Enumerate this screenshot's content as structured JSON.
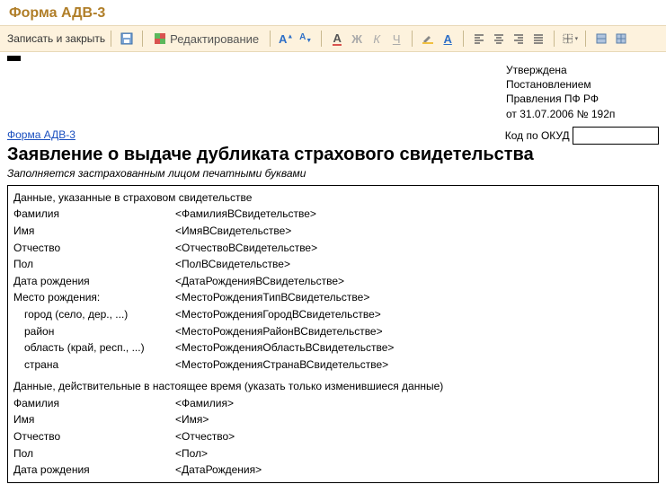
{
  "window_title": "Форма АДВ-3",
  "toolbar": {
    "save_close": "Записать и закрыть",
    "edit": "Редактирование"
  },
  "approval": {
    "l1": "Утверждена",
    "l2": "Постановлением",
    "l3": "Правления ПФ РФ",
    "l4": "от 31.07.2006 № 192п"
  },
  "form_link": "Форма АДВ-3",
  "okud_label": "Код по ОКУД",
  "okud_value": "",
  "doc_title": "Заявление о выдаче дубликата страхового свидетельства",
  "subtitle": "Заполняется застрахованным лицом печатными буквами",
  "section1_header": "Данные, указанные в  страховом свидетельстве",
  "section2_header": "Данные, действительные в настоящее время (указать только изменившиеся данные)",
  "s1": {
    "surname_l": "Фамилия",
    "surname_v": "<ФамилияВСвидетельстве>",
    "name_l": "Имя",
    "name_v": "<ИмяВСвидетельстве>",
    "patr_l": "Отчество",
    "patr_v": "<ОтчествоВСвидетельстве>",
    "sex_l": "Пол",
    "sex_v": "<ПолВСвидетельстве>",
    "dob_l": "Дата рождения",
    "dob_v": "<ДатаРожденияВСвидетельстве>",
    "pob_l": "Место рождения:",
    "pob_v": "<МестоРожденияТипВСвидетельстве>",
    "city_l": "город (село, дер., ...)",
    "city_v": "<МестоРожденияГородВСвидетельстве>",
    "rayon_l": "район",
    "rayon_v": "<МестоРожденияРайонВСвидетельстве>",
    "obl_l": "область (край, респ., ...)",
    "obl_v": "<МестоРожденияОбластьВСвидетельстве>",
    "country_l": "страна",
    "country_v": "<МестоРожденияСтранаВСвидетельстве>"
  },
  "s2": {
    "surname_l": "Фамилия",
    "surname_v": "<Фамилия>",
    "name_l": "Имя",
    "name_v": "<Имя>",
    "patr_l": "Отчество",
    "patr_v": "<Отчество>",
    "sex_l": "Пол",
    "sex_v": "<Пол>",
    "dob_l": "Дата рождения",
    "dob_v": "<ДатаРождения>"
  }
}
